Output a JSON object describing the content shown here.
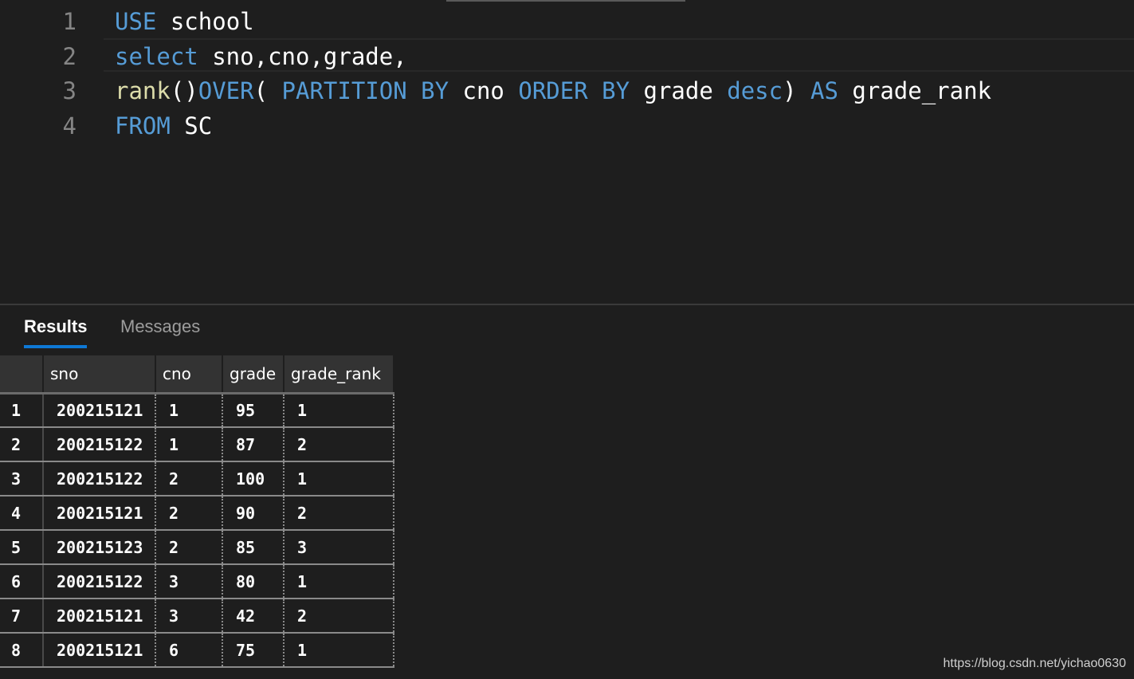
{
  "editor": {
    "lines": [
      {
        "number": "1",
        "tokens": [
          {
            "t": "USE",
            "c": "kw"
          },
          {
            "t": " school",
            "c": "id"
          }
        ]
      },
      {
        "number": "2",
        "tokens": [
          {
            "t": "select",
            "c": "kw"
          },
          {
            "t": " sno,cno,grade,",
            "c": "id"
          }
        ]
      },
      {
        "number": "3",
        "tokens": [
          {
            "t": "rank",
            "c": "fn"
          },
          {
            "t": "()",
            "c": "pn"
          },
          {
            "t": "OVER",
            "c": "kw"
          },
          {
            "t": "( ",
            "c": "pn"
          },
          {
            "t": "PARTITION BY",
            "c": "kw"
          },
          {
            "t": " cno ",
            "c": "id"
          },
          {
            "t": "ORDER BY",
            "c": "kw"
          },
          {
            "t": " grade ",
            "c": "id"
          },
          {
            "t": "desc",
            "c": "kw"
          },
          {
            "t": ") ",
            "c": "pn"
          },
          {
            "t": "AS",
            "c": "kw"
          },
          {
            "t": " grade_rank",
            "c": "id"
          }
        ]
      },
      {
        "number": "4",
        "tokens": [
          {
            "t": "FROM",
            "c": "kw"
          },
          {
            "t": " SC",
            "c": "id"
          }
        ]
      }
    ]
  },
  "results": {
    "tabs": {
      "results_label": "Results",
      "messages_label": "Messages"
    },
    "columns": [
      "sno",
      "cno",
      "grade",
      "grade_rank"
    ],
    "rows": [
      [
        "1",
        "200215121",
        "1",
        "95",
        "1"
      ],
      [
        "2",
        "200215122",
        "1",
        "87",
        "2"
      ],
      [
        "3",
        "200215122",
        "2",
        "100",
        "1"
      ],
      [
        "4",
        "200215121",
        "2",
        "90",
        "2"
      ],
      [
        "5",
        "200215123",
        "2",
        "85",
        "3"
      ],
      [
        "6",
        "200215122",
        "3",
        "80",
        "1"
      ],
      [
        "7",
        "200215121",
        "3",
        "42",
        "2"
      ],
      [
        "8",
        "200215121",
        "6",
        "75",
        "1"
      ]
    ]
  },
  "watermark": "https://blog.csdn.net/yichao0630",
  "colors": {
    "keyword": "#569cd6",
    "function": "#dcdcaa",
    "text": "#ffffff",
    "background": "#1e1e1e",
    "accent": "#0e78d5"
  }
}
